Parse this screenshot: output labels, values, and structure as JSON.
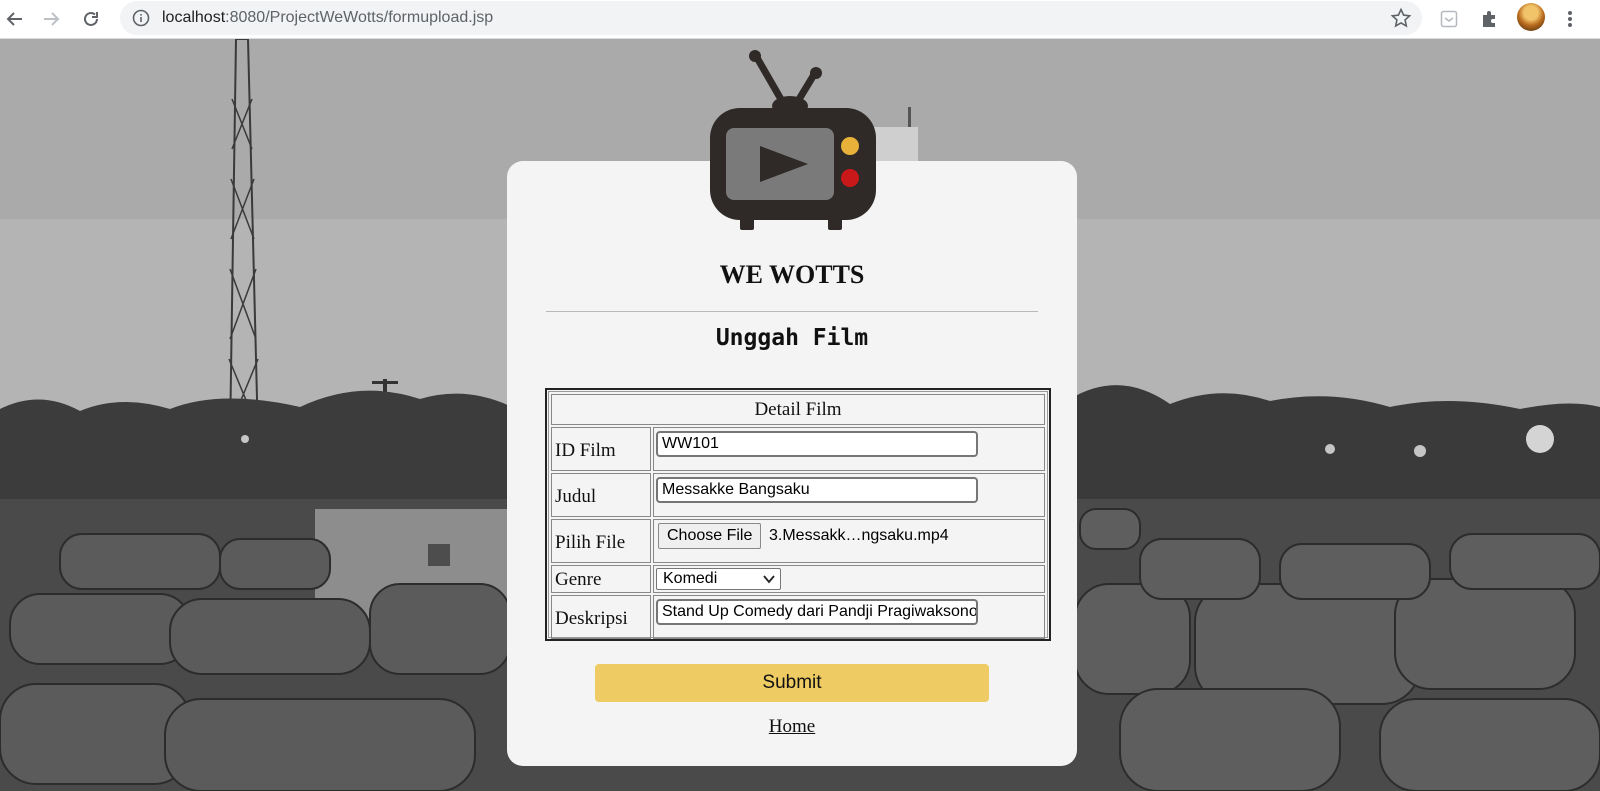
{
  "browser": {
    "url_host": "localhost",
    "url_rest": ":8080/ProjectWeWotts/formupload.jsp"
  },
  "page": {
    "brand": "WE WOTTS",
    "title": "Unggah Film"
  },
  "form": {
    "header": "Detail Film",
    "fields": {
      "id_film": {
        "label": "ID Film",
        "value": "WW101"
      },
      "judul": {
        "label": "Judul",
        "value": "Messakke Bangsaku"
      },
      "file": {
        "label": "Pilih File",
        "button": "Choose File",
        "filename": "3.Messakk…ngsaku.mp4"
      },
      "genre": {
        "label": "Genre",
        "selected": "Komedi"
      },
      "deskripsi": {
        "label": "Deskripsi",
        "value": "Stand Up Comedy dari Pandji Pragiwaksono"
      }
    },
    "submit": "Submit",
    "home": "Home"
  },
  "colors": {
    "card_bg": "#f4f4f4",
    "submit_bg": "#eecb63",
    "tv_body": "#2f2a27",
    "tv_screen": "#7a7a7a",
    "tv_led_yellow": "#e8b23a",
    "tv_led_red": "#c8181a"
  },
  "icons": [
    "back-icon",
    "forward-icon",
    "reload-icon",
    "info-icon",
    "star-icon",
    "reading-list-icon",
    "extensions-icon",
    "menu-icon",
    "tv-logo-icon"
  ]
}
